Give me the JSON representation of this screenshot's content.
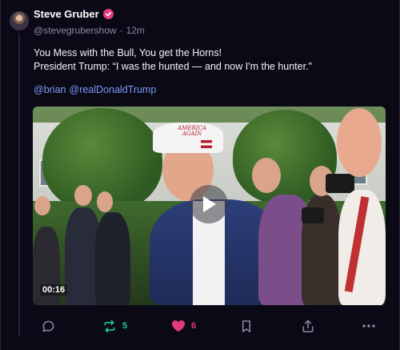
{
  "post": {
    "author": {
      "display_name": "Steve Gruber",
      "handle": "@stevegrubershow",
      "separator": "·",
      "time": "12m"
    },
    "text_line1": "You Mess with the Bull, You get the Horns!",
    "text_line2": "President Trump: “I was the hunted — and now I'm the hunter.\"",
    "mentions": [
      "@brian",
      "@realDonaldTrump"
    ]
  },
  "video": {
    "timecode": "00:16",
    "hat_line1": "AMERICA",
    "hat_line2": "AGAIN"
  },
  "actions": {
    "reply": {
      "icon": "reply-icon"
    },
    "repost": {
      "icon": "repost-icon",
      "count": "5"
    },
    "like": {
      "icon": "heart-icon",
      "count": "6"
    },
    "bookmark": {
      "icon": "bookmark-icon"
    },
    "share": {
      "icon": "share-icon"
    },
    "more": {
      "icon": "more-icon"
    }
  },
  "colors": {
    "background": "#0a0915",
    "mention": "#7b9cf5",
    "repost": "#1ec99b",
    "like": "#e23c7d",
    "muted": "#8b8aa0"
  }
}
